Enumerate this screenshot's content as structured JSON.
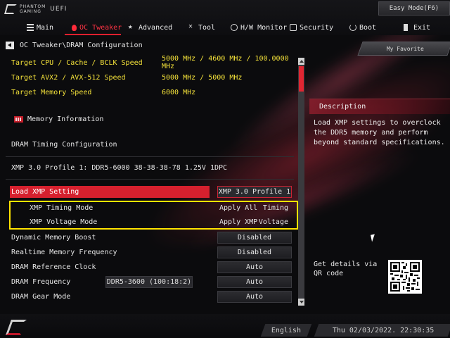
{
  "brand": {
    "line1": "PHANTOM",
    "line2": "GAMING",
    "uefi": "UEFI"
  },
  "easy_mode": "Easy Mode(F6)",
  "nav": [
    {
      "label": "Main",
      "icon": "main-menu-icon"
    },
    {
      "label": "OC Tweaker",
      "icon": "flame-icon"
    },
    {
      "label": "Advanced",
      "icon": "star-icon"
    },
    {
      "label": "Tool",
      "icon": "tool-icon"
    },
    {
      "label": "H/W Monitor",
      "icon": "monitor-icon"
    },
    {
      "label": "Security",
      "icon": "security-icon"
    },
    {
      "label": "Boot",
      "icon": "power-icon"
    },
    {
      "label": "Exit",
      "icon": "exit-icon"
    }
  ],
  "breadcrumb": "OC Tweaker\\DRAM Configuration",
  "my_favorite": "My Favorite",
  "info": [
    {
      "label": "Target CPU / Cache / BCLK Speed",
      "value": "5000 MHz / 4600 MHz / 100.0000 MHz"
    },
    {
      "label": "Target AVX2 / AVX-512 Speed",
      "value": "5000 MHz / 5000 MHz"
    },
    {
      "label": "Target Memory Speed",
      "value": "6000 MHz"
    }
  ],
  "memory_information": "Memory Information",
  "dram_timing_config": "DRAM Timing Configuration",
  "xmp_profile": "XMP 3.0 Profile 1: DDR5-6000 38-38-38-78 1.25V 1DPC",
  "load_xmp": {
    "label": "Load XMP Setting",
    "value": "XMP 3.0 Profile 1"
  },
  "xmp_timing": {
    "label": "XMP Timing Mode",
    "a": "Apply All",
    "b": "Timing"
  },
  "xmp_voltage": {
    "label": "XMP Voltage Mode",
    "a": "Apply XMP",
    "b": "Voltage"
  },
  "settings": [
    {
      "label": "Dynamic Memory Boost",
      "value": "Disabled"
    },
    {
      "label": "Realtime Memory Frequency",
      "value": "Disabled"
    },
    {
      "label": "DRAM Reference Clock",
      "value": "Auto"
    },
    {
      "label": "DRAM Frequency",
      "extra": "DDR5-3600 (100:18:2)",
      "value": "Auto"
    },
    {
      "label": "DRAM Gear Mode",
      "value": "Auto"
    }
  ],
  "description": {
    "title": "Description",
    "text": "Load XMP settings to overclock the DDR5 memory and perform beyond standard specifications."
  },
  "qr_text": "Get details via QR code",
  "language": "English",
  "datetime": "Thu 02/03/2022. 22:30:35",
  "colors": {
    "accent": "#d6202e",
    "highlight": "#ffe400",
    "info_text": "#f4e23a"
  }
}
